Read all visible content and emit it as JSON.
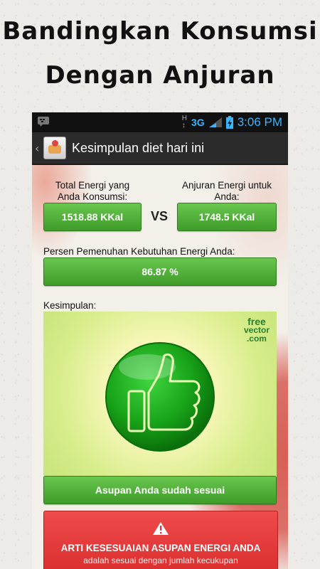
{
  "promo": {
    "line1": "Bandingkan Konsumsi",
    "line2": "Dengan Anjuran"
  },
  "status_bar": {
    "network": "3G",
    "time": "3:06 PM"
  },
  "action_bar": {
    "title": "Kesimpulan diet hari ini"
  },
  "energy": {
    "consumed_label": "Total Energi yang Anda Konsumsi:",
    "consumed_value": "1518.88 KKal",
    "vs_label": "VS",
    "recommended_label": "Anjuran Energi untuk Anda:",
    "recommended_value": "1748.5 KKal"
  },
  "fulfillment": {
    "label": "Persen Pemenuhan Kebutuhan Energi Anda:",
    "value": "86.87 %"
  },
  "conclusion": {
    "label": "Kesimpulan:",
    "watermark_line1": "free",
    "watermark_line2": "vector",
    "watermark_line3": ".com",
    "result_button": "Asupan Anda sudah sesuai"
  },
  "info_box": {
    "title": "ARTI KESESUAIAN ASUPAN ENERGI ANDA",
    "subtitle": "adalah sesuai dengan jumlah kecukupan"
  },
  "colors": {
    "accent_green": "#4caf35",
    "alert_red": "#e53935",
    "status_blue": "#3ab5ff"
  },
  "icons": {
    "status_left": "bbm-icon",
    "signal": "signal-icon",
    "battery": "battery-icon",
    "illustration": "thumbs-up-icon",
    "alert": "warning-icon"
  }
}
